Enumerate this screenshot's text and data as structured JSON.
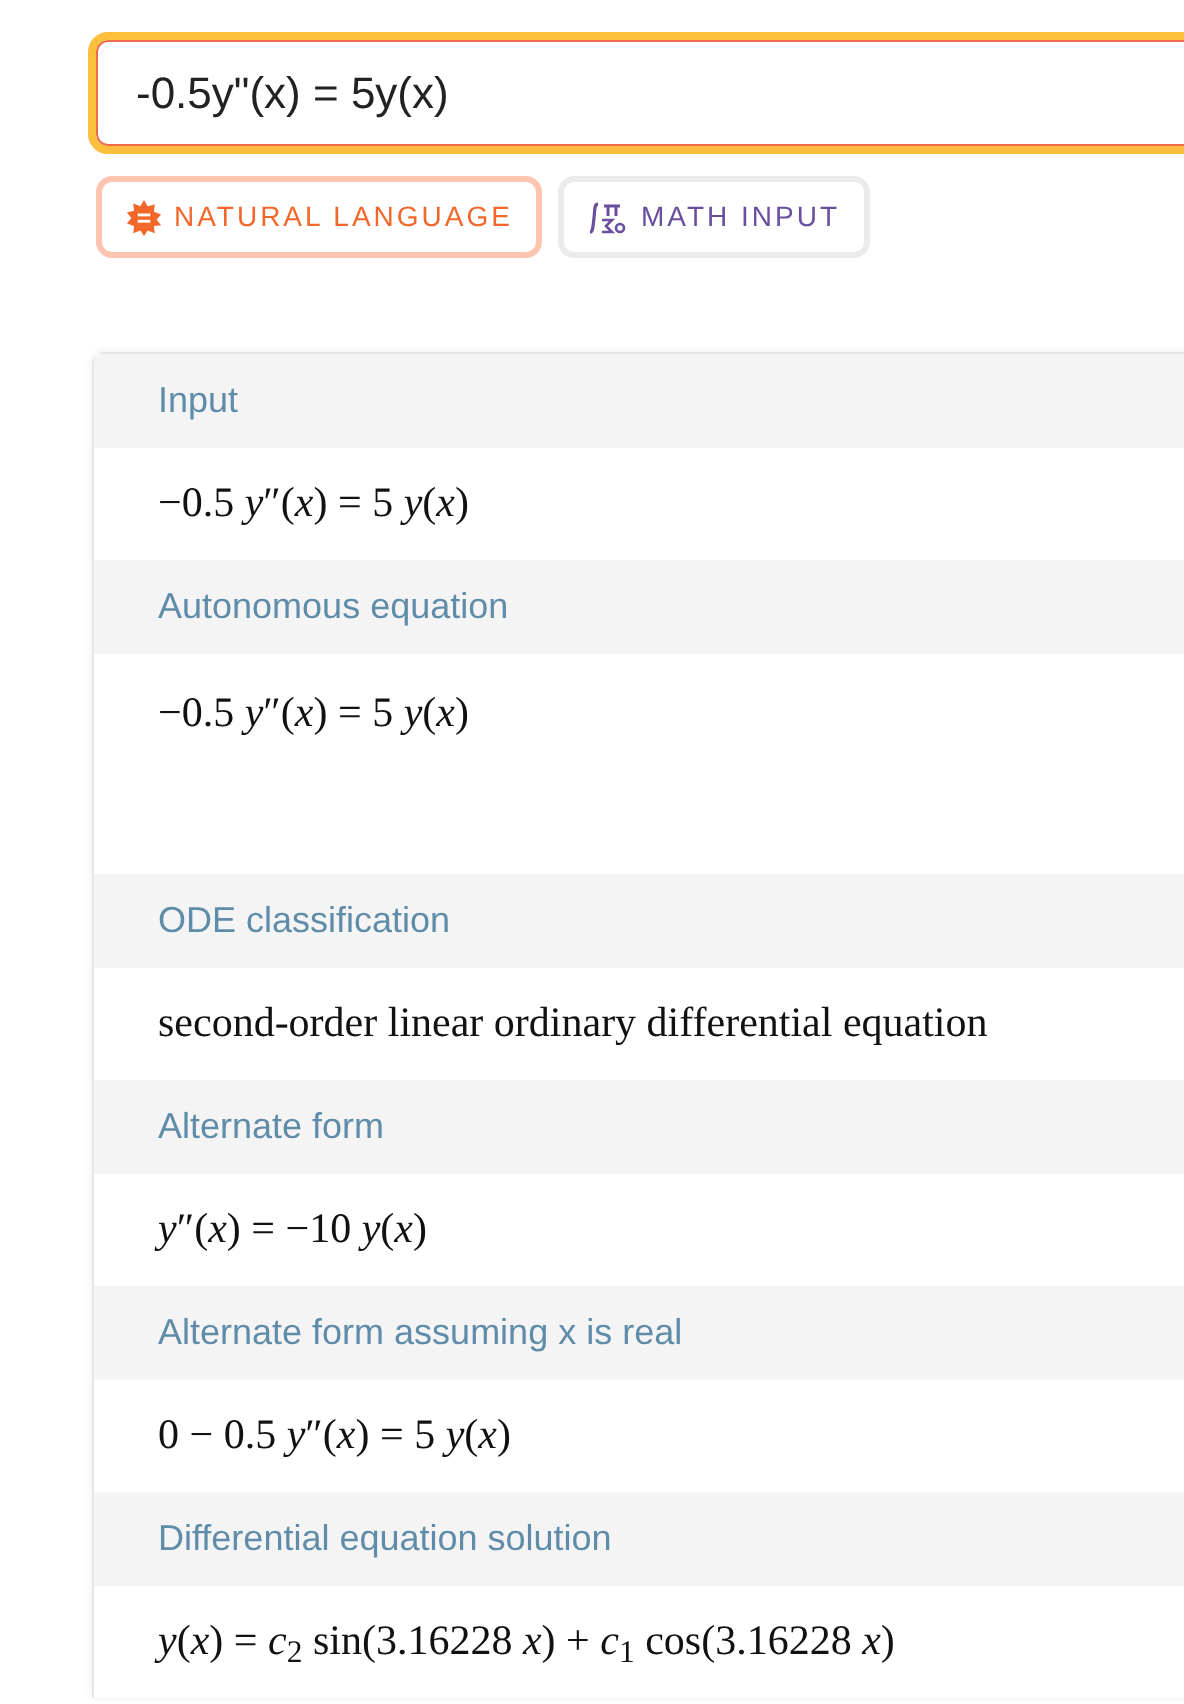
{
  "query": {
    "value": "-0.5y\"(x) = 5y(x)"
  },
  "modes": [
    {
      "label": "NATURAL LANGUAGE",
      "selected": true,
      "kind": "natural"
    },
    {
      "label": "MATH INPUT",
      "selected": false,
      "kind": "math"
    }
  ],
  "pods": [
    {
      "title": "Input",
      "content": "−0.5 *y*″(*x*) = 5 *y*(*x*)",
      "tall": false
    },
    {
      "title": "Autonomous equation",
      "content": "−0.5 *y*″(*x*) = 5 *y*(*x*)",
      "tall": true
    },
    {
      "title": "ODE classification",
      "content": "second-order linear ordinary differential equation",
      "tall": false
    },
    {
      "title": "Alternate form",
      "content": "*y*″(*x*) = −10 *y*(*x*)",
      "tall": false
    },
    {
      "title": "Alternate form assuming x is real",
      "content": "0 − 0.5 *y*″(*x*) = 5 *y*(*x*)",
      "tall": false
    },
    {
      "title": "Differential equation solution",
      "content": "*y*(*x*) = *c*$_{2}$ sin(3.16228 *x*) + *c*$_{1}$ cos(3.16228 *x*)",
      "tall": false
    }
  ]
}
